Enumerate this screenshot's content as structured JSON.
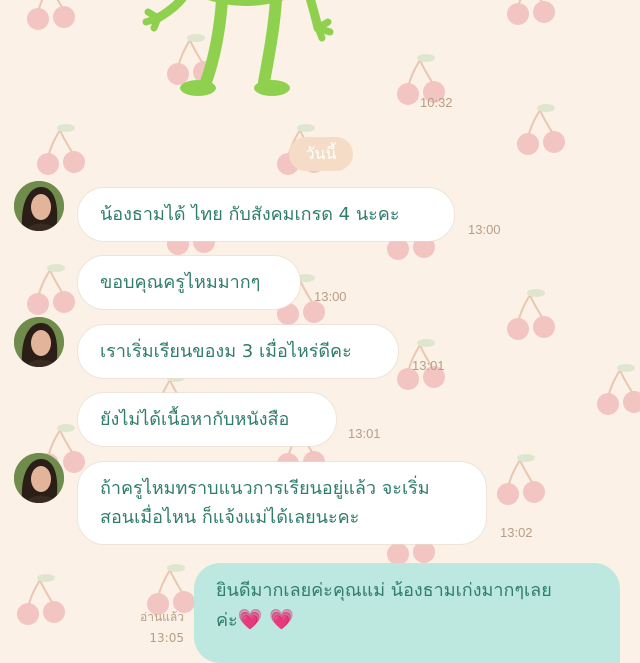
{
  "sticker": {
    "time": "10:32"
  },
  "date_divider": "วันนี้",
  "messages": [
    {
      "text": "น้องธามได้ ไทย กับสังคมเกรด 4 นะคะ",
      "time": "13:00"
    },
    {
      "text": "ขอบคุณครูไหมมากๆ",
      "time": "13:00"
    },
    {
      "text": "เราเริ่มเรียนของม 3 เมื่อไหร่ดีคะ",
      "time": "13:01"
    },
    {
      "text": "ยังไม่ได้เนื้อหากับหนังสือ",
      "time": "13:01"
    },
    {
      "text_line1": "ถ้าครูไหมทราบแนวการเรียนอยู่แล้ว จะเริ่ม",
      "text_line2": "สอนเมื่อไหน ก็แจ้งแม่ได้เลยนะคะ",
      "time": "13:02"
    }
  ],
  "outgoing": {
    "text_line1": "ยินดีมากเลยค่ะคุณแม่ น้องธามเก่งมากๆเลย",
    "text_line2": "ค่ะ",
    "read_label": "อ่านแล้ว",
    "time": "13:05"
  },
  "colors": {
    "background": "#fbf1e6",
    "incoming_text": "#2f7d6d",
    "outgoing_bubble": "#bde8e0",
    "timestamp": "#b89e86"
  },
  "icons": [
    "cherry-pattern",
    "heart-icon",
    "frog-sticker",
    "avatar-photo"
  ]
}
